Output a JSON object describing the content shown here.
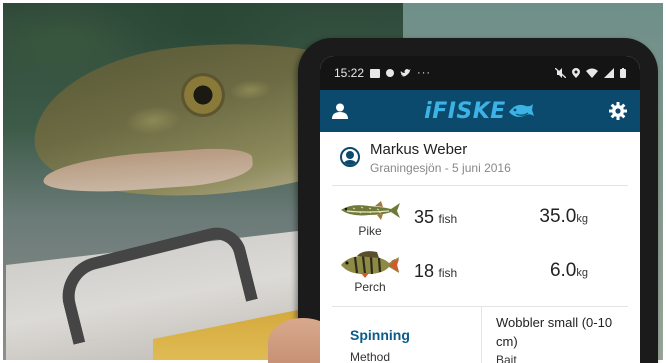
{
  "status_bar": {
    "time": "15:22",
    "overflow": "···"
  },
  "app_bar": {
    "logo": "iFISKE",
    "profile_icon": "person-icon",
    "settings_icon": "gear-icon"
  },
  "catch_report": {
    "user_name": "Markus Weber",
    "subtitle": "Graningesjön - 5 juni 2016",
    "catches": [
      {
        "species": "Pike",
        "count": "35",
        "count_unit": "fish",
        "weight": "35.0",
        "weight_unit": "kg"
      },
      {
        "species": "Perch",
        "count": "18",
        "count_unit": "fish",
        "weight": "6.0",
        "weight_unit": "kg"
      }
    ],
    "method_value": "Spinning",
    "method_label": "Method",
    "bait_value": "Wobbler small (0-10 cm)",
    "bait_label": "Bait"
  },
  "colors": {
    "app_bar_bg": "#0b4a6c",
    "logo": "#3bb3e4",
    "method_accent": "#0b5c8a"
  }
}
